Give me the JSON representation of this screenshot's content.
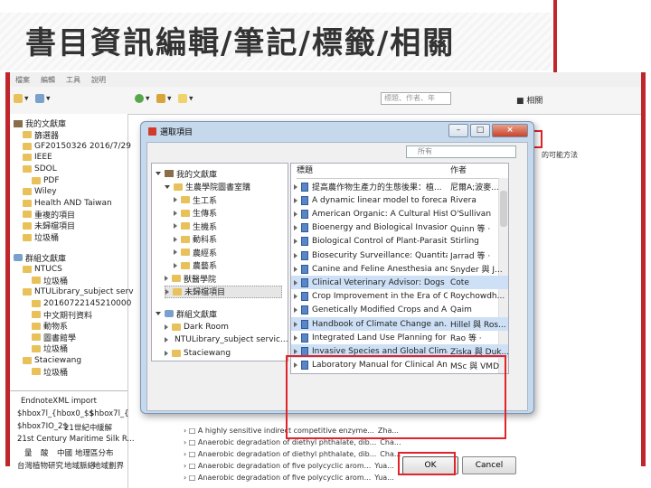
{
  "slide": {
    "title": "書目資訊編輯/筆記/標籤/相關"
  },
  "app": {
    "menu": [
      "檔案",
      "編輯",
      "工具",
      "說明"
    ],
    "search_value": "標題、作者、年",
    "right_info": "的可能方法"
  },
  "library_tree": [
    "我的文獻庫",
    "篩選器",
    "GF20150326 2016/7/29",
    "IEEE",
    "SDOL",
    "PDF",
    "Wiley",
    "Health AND Taiwan",
    "重複的項目",
    "未歸檔項目",
    "垃圾桶",
    "群組文獻庫",
    "NTUCS",
    "垃圾桶",
    "NTULibrary_subject serv",
    "20160722145210000",
    "中文期刊資料",
    "動物系",
    "圖書館學",
    "垃圾桶",
    "Staciewang",
    "垃圾桶"
  ],
  "tags": [
    "EndnoteXML import",
    "$hbox7l_{hbox0_$$",
    "$hbox7l_{",
    "$hbox7IO_2$",
    "21世紀中",
    "緩解",
    "21st Century Maritime Silk R...",
    "量",
    "酸",
    "中國",
    "地理區分布",
    "台灣植物研究",
    "地域脈絡",
    "地域劃界"
  ],
  "bg_list": [
    {
      "title": "A highly sensitive indirect competitive enzyme...",
      "author": "Zha..."
    },
    {
      "title": "Anaerobic degradation of diethyl phthalate, dib...",
      "author": "Cha..."
    },
    {
      "title": "Anaerobic degradation of diethyl phthalate, dib...",
      "author": "Cha..."
    },
    {
      "title": "Anaerobic degradation of five polycyclic arom...",
      "author": "Yua..."
    },
    {
      "title": "Anaerobic degradation of five polycyclic arom...",
      "author": "Yua..."
    }
  ],
  "dialog": {
    "title": "選取項目",
    "close": "×",
    "minimize": "–",
    "maximize": "□",
    "search_placeholder": "所有",
    "tree": [
      {
        "label": "我的文獻庫",
        "level": 0,
        "type": "lib",
        "open": true
      },
      {
        "label": "生農學院圖書室購",
        "level": 1,
        "type": "folder",
        "open": true
      },
      {
        "label": "生工系",
        "level": 2,
        "type": "folder"
      },
      {
        "label": "生傳系",
        "level": 2,
        "type": "folder"
      },
      {
        "label": "生機系",
        "level": 2,
        "type": "folder"
      },
      {
        "label": "動科系",
        "level": 2,
        "type": "folder"
      },
      {
        "label": "農經系",
        "level": 2,
        "type": "folder"
      },
      {
        "label": "農藝系",
        "level": 2,
        "type": "folder"
      },
      {
        "label": "獸醫學院",
        "level": 1,
        "type": "folder"
      },
      {
        "label": "未歸檔項目",
        "level": 1,
        "type": "folder",
        "selected": true
      },
      {
        "label": "群組文獻庫",
        "level": 0,
        "type": "grp",
        "open": true
      },
      {
        "label": "Dark Room",
        "level": 1,
        "type": "folder"
      },
      {
        "label": "NTULibrary_subject servic...",
        "level": 1,
        "type": "folder"
      },
      {
        "label": "Staciewang",
        "level": 1,
        "type": "folder"
      }
    ],
    "columns": {
      "title": "標題",
      "author": "作者"
    },
    "rows": [
      {
        "title": "提高農作物生產力的生態後果：植...",
        "author": "尼爾A;波麥..."
      },
      {
        "title": "A dynamic linear model to foreca...",
        "author": "Rivera"
      },
      {
        "title": "American Organic: A Cultural Hist...",
        "author": "O'Sullivan"
      },
      {
        "title": "Bioenergy and Biological Invasion...",
        "author": "Quinn 等 ·"
      },
      {
        "title": "Biological Control of Plant-Parasit...",
        "author": "Stirling"
      },
      {
        "title": "Biosecurity Surveillance: Quantitat...",
        "author": "Jarrad 等 ·"
      },
      {
        "title": "Canine and Feline Anesthesia and ...",
        "author": "Snyder 與 J..."
      },
      {
        "title": "Clinical Veterinary Advisor: Dogs a...",
        "author": "Cote",
        "selected": true
      },
      {
        "title": "Crop Improvement in the Era of Cl...",
        "author": "Roychowdh..."
      },
      {
        "title": "Genetically Modified Crops and A...",
        "author": "Qaim"
      },
      {
        "title": "Handbook of Climate Change an...",
        "author": "Hillel 與 Ros...",
        "selected": true
      },
      {
        "title": "Integrated Land Use Planning for ...",
        "author": "Rao 等 ·"
      },
      {
        "title": "Invasive Species and Global Clima...",
        "author": "Ziska 與 Duk...",
        "selected": true
      },
      {
        "title": "Laboratory Manual for Clinical An...",
        "author": "MSc 與 VMD"
      }
    ],
    "ok_label": "OK",
    "cancel_label": "Cancel"
  }
}
